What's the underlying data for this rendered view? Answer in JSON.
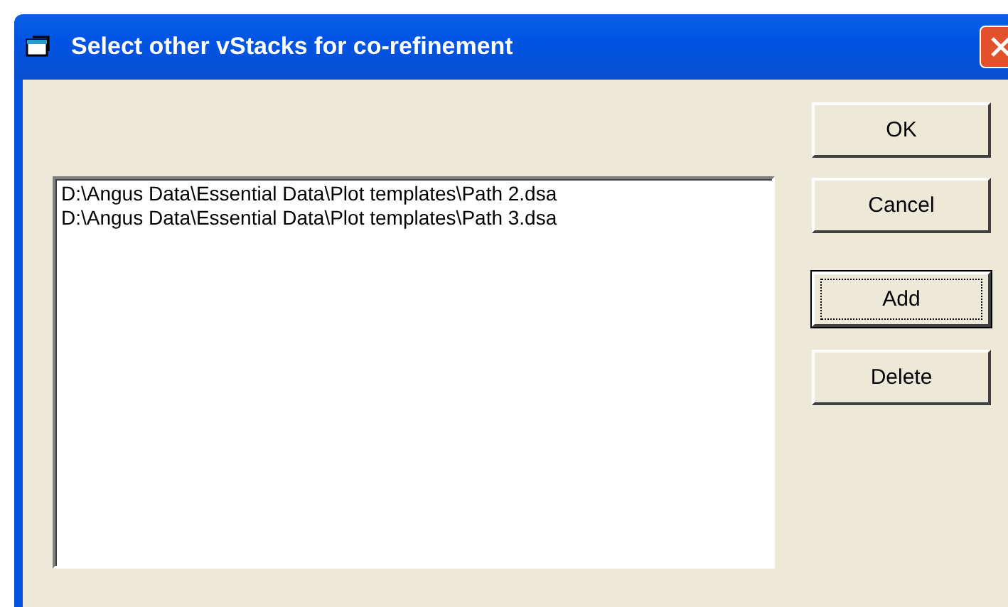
{
  "window": {
    "title": "Select other vStacks for co-refinement"
  },
  "list": {
    "items": [
      {
        "text": "D:\\Angus Data\\Essential Data\\Plot templates\\Path 2.dsa",
        "selected": false
      },
      {
        "text": "D:\\Angus Data\\Essential Data\\Plot templates\\Path 3.dsa",
        "selected": false
      }
    ]
  },
  "buttons": [
    {
      "label": "OK",
      "focused": false
    },
    {
      "label": "Cancel",
      "focused": false
    },
    {
      "label": "Add",
      "focused": true
    },
    {
      "label": "Delete",
      "focused": false
    }
  ]
}
